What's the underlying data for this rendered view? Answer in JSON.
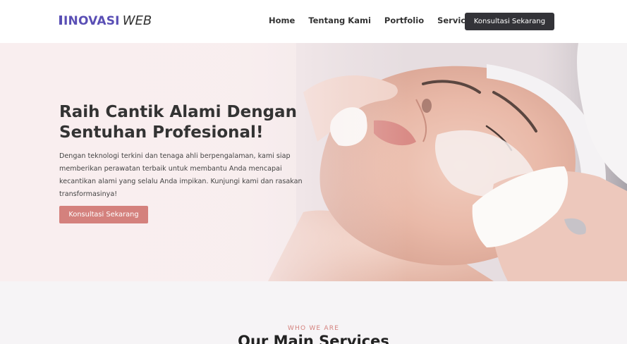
{
  "brand": {
    "name_bold": "INOVASI",
    "name_light": "WEB"
  },
  "nav": {
    "items": [
      {
        "label": "Home"
      },
      {
        "label": "Tentang Kami"
      },
      {
        "label": "Portfolio"
      },
      {
        "label": "Service"
      }
    ],
    "cta_label": "Konsultasi Sekarang"
  },
  "hero": {
    "title": "Raih Cantik Alami Dengan Sentuhan Profesional!",
    "text": "Dengan teknologi terkini dan tenaga ahli berpengalaman, kami siap memberikan perawatan terbaik untuk membantu Anda mencapai kecantikan alami yang selalu Anda impikan. Kunjungi kami dan rasakan transformasinya!",
    "cta_label": "Konsultasi Sekarang"
  },
  "services": {
    "eyebrow": "WHO WE ARE",
    "title": "Our Main Services"
  },
  "colors": {
    "brand_purple": "#5a4fb5",
    "dark_button": "#333338",
    "accent_rose": "#d4817d",
    "hero_bg": "#f7ebec",
    "section_bg": "#f6f4f6"
  }
}
